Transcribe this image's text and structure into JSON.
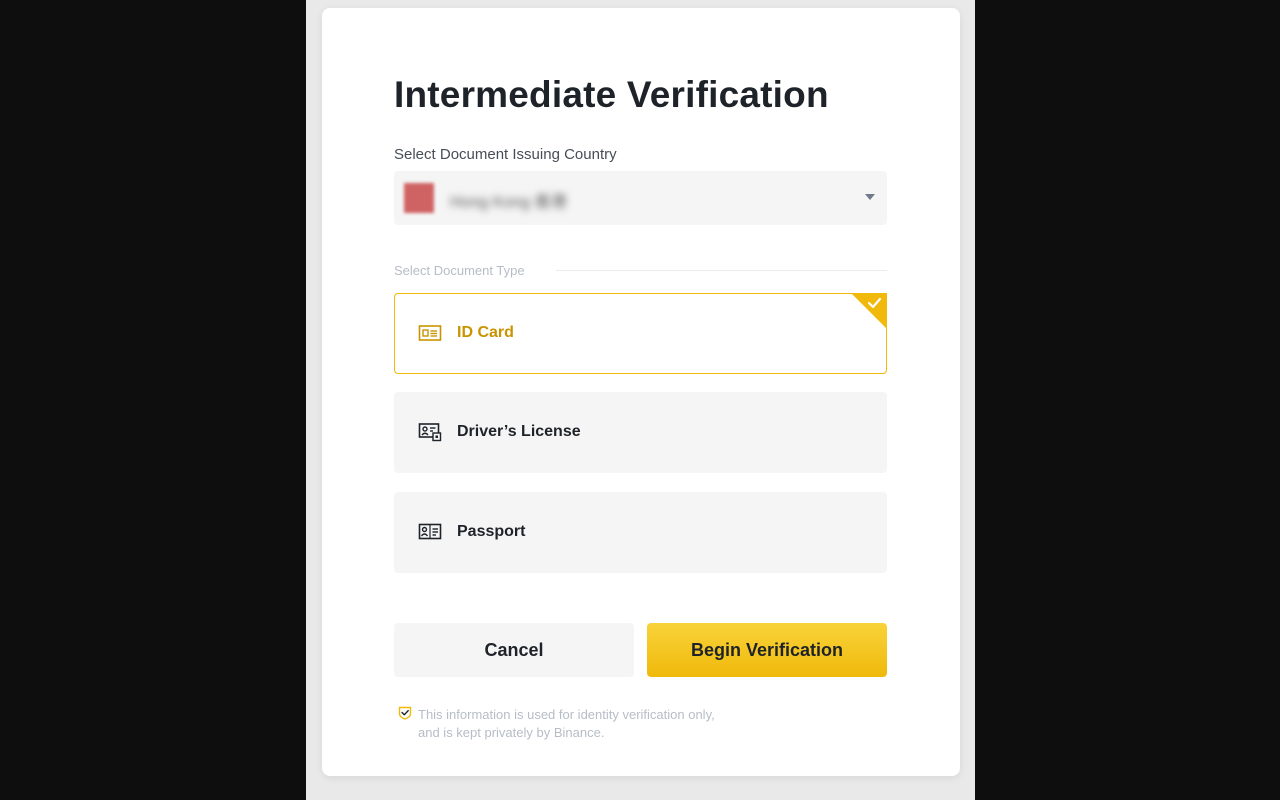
{
  "modal": {
    "title": "Intermediate Verification",
    "country_label": "Select Document Issuing Country",
    "country_value": "Hong Kong 香港",
    "doc_type_label": "Select Document Type",
    "options": [
      {
        "label": "ID Card",
        "icon": "id-card-icon",
        "selected": true
      },
      {
        "label": "Driver’s License",
        "icon": "drivers-license-icon",
        "selected": false
      },
      {
        "label": "Passport",
        "icon": "passport-icon",
        "selected": false
      }
    ],
    "cancel_label": "Cancel",
    "begin_label": "Begin Verification",
    "notice_line1": "This information is used for identity verification only,",
    "notice_line2": "and is kept privately by Binance."
  },
  "colors": {
    "accent": "#f0b90b",
    "accent_text": "#c99400",
    "text": "#1e2329",
    "muted": "#b7bdc6"
  }
}
